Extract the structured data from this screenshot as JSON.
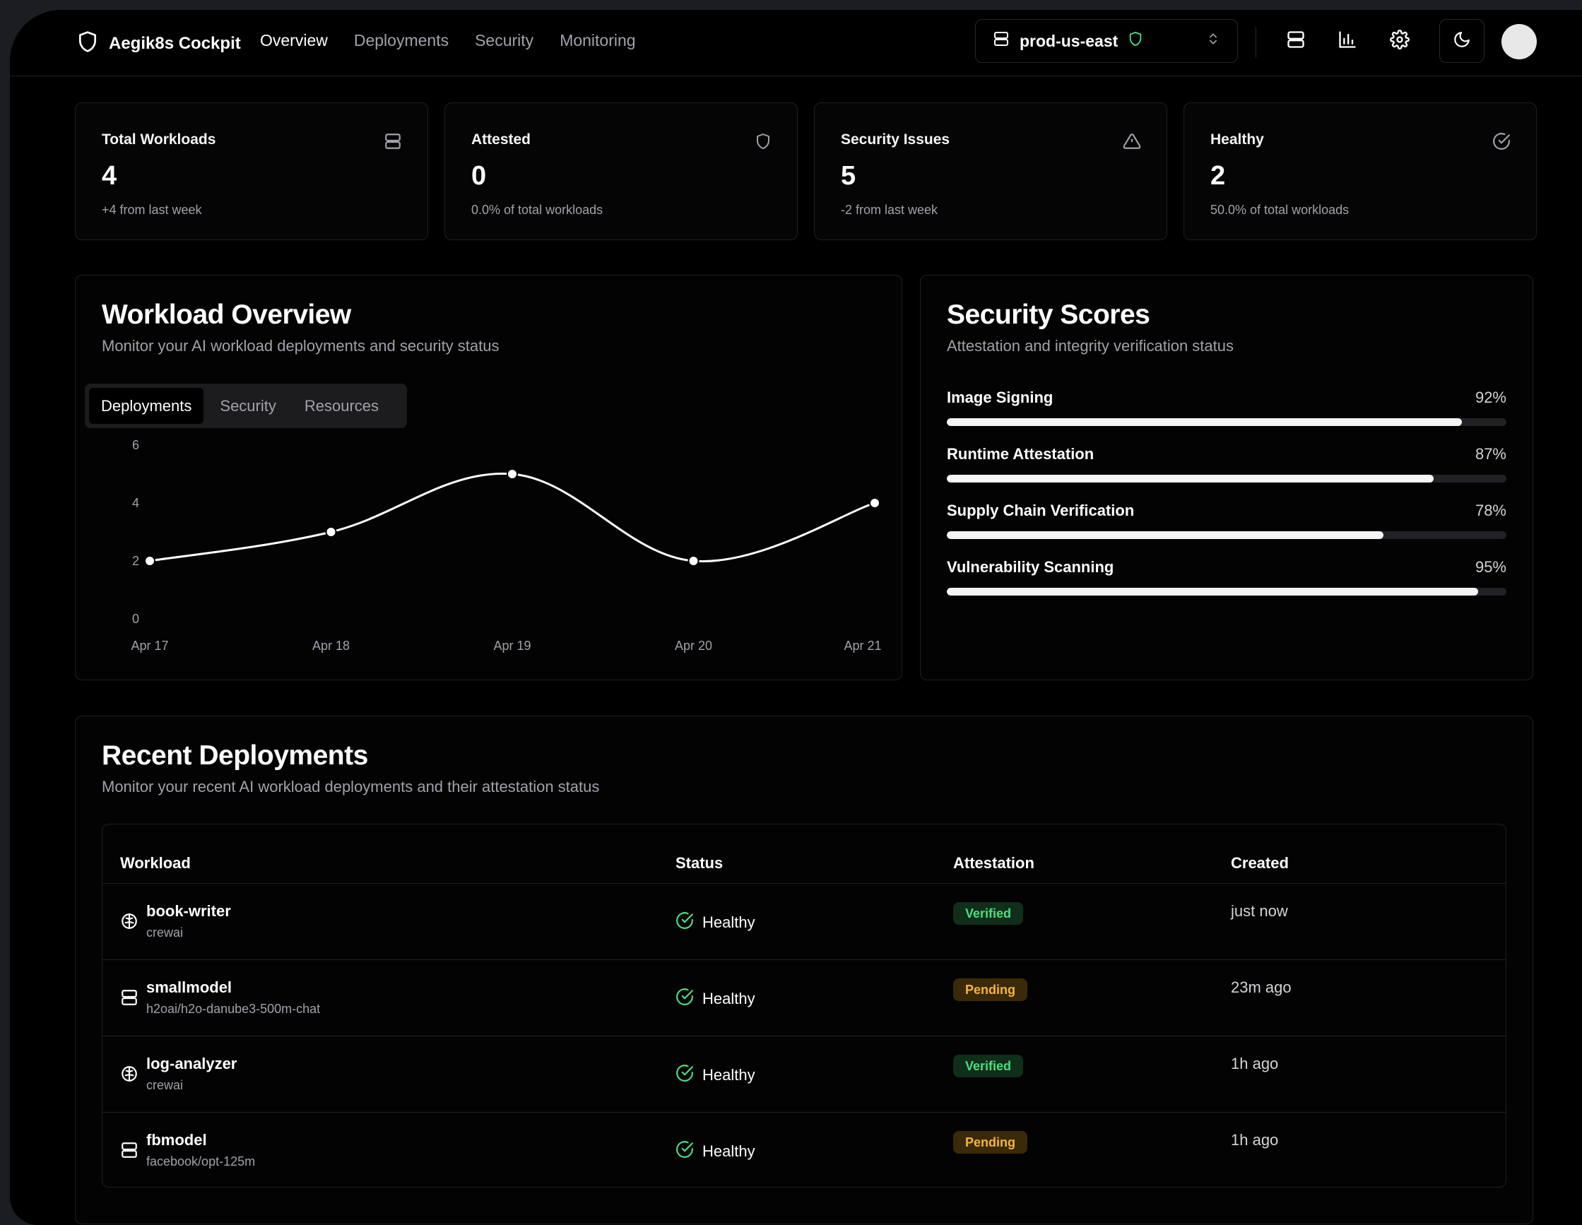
{
  "app": {
    "name": "Aegik8s Cockpit",
    "nav": [
      "Overview",
      "Deployments",
      "Security",
      "Monitoring"
    ],
    "active_nav": "Overview",
    "cluster": "prod-us-east"
  },
  "stats": [
    {
      "title": "Total Workloads",
      "value": "4",
      "sub": "+4 from last week",
      "icon": "server-icon"
    },
    {
      "title": "Attested",
      "value": "0",
      "sub": "0.0% of total workloads",
      "icon": "shield-icon"
    },
    {
      "title": "Security Issues",
      "value": "5",
      "sub": "-2 from last week",
      "icon": "alert-triangle-icon"
    },
    {
      "title": "Healthy",
      "value": "2",
      "sub": "50.0% of total workloads",
      "icon": "check-circle-icon"
    }
  ],
  "workload_overview": {
    "title": "Workload Overview",
    "subtitle": "Monitor your AI workload deployments and security status",
    "tabs": [
      "Deployments",
      "Security",
      "Resources"
    ],
    "active_tab": "Deployments"
  },
  "chart_data": {
    "type": "line",
    "x": [
      "Apr 17",
      "Apr 18",
      "Apr 19",
      "Apr 20",
      "Apr 21"
    ],
    "series": [
      {
        "values": [
          2,
          3,
          5,
          2,
          4
        ]
      }
    ],
    "yticks": [
      0,
      2,
      4,
      6
    ],
    "ylim": [
      0,
      6
    ],
    "grid": false,
    "line_color": "#ffffff"
  },
  "security_scores": {
    "title": "Security Scores",
    "subtitle": "Attestation and integrity verification status",
    "items": [
      {
        "label": "Image Signing",
        "value": 92,
        "display": "92%"
      },
      {
        "label": "Runtime Attestation",
        "value": 87,
        "display": "87%"
      },
      {
        "label": "Supply Chain Verification",
        "value": 78,
        "display": "78%"
      },
      {
        "label": "Vulnerability Scanning",
        "value": 95,
        "display": "95%"
      }
    ]
  },
  "recent_deployments": {
    "title": "Recent Deployments",
    "subtitle": "Monitor your recent AI workload deployments and their attestation status",
    "columns": [
      "Workload",
      "Status",
      "Attestation",
      "Created"
    ],
    "rows": [
      {
        "name": "book-writer",
        "sub": "crewai",
        "icon": "brain-icon",
        "status": "Healthy",
        "attestation": "Verified",
        "created": "just now"
      },
      {
        "name": "smallmodel",
        "sub": "h2oai/h2o-danube3-500m-chat",
        "icon": "server-icon",
        "status": "Healthy",
        "attestation": "Pending",
        "created": "23m ago"
      },
      {
        "name": "log-analyzer",
        "sub": "crewai",
        "icon": "brain-icon",
        "status": "Healthy",
        "attestation": "Verified",
        "created": "1h ago"
      },
      {
        "name": "fbmodel",
        "sub": "facebook/opt-125m",
        "icon": "server-icon",
        "status": "Healthy",
        "attestation": "Pending",
        "created": "1h ago"
      }
    ]
  },
  "colors": {
    "background": "#000000",
    "healthy_green": "#4ade80",
    "pending_amber": "#f5b43c"
  }
}
